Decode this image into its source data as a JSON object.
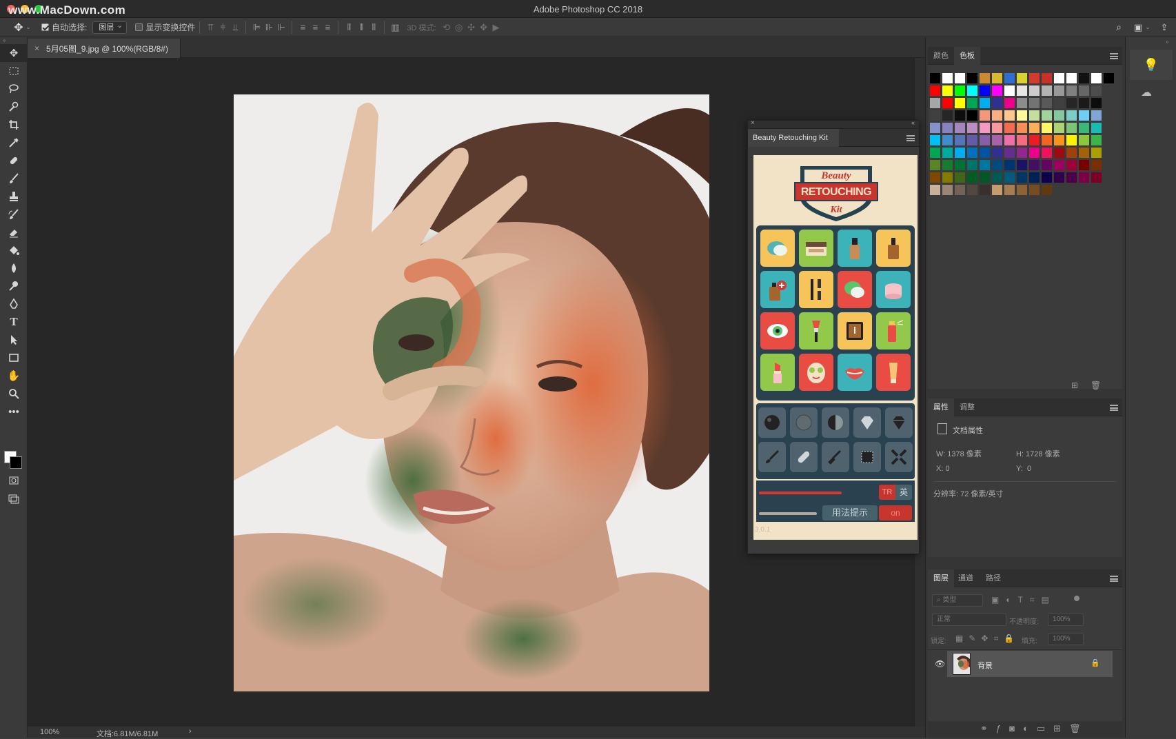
{
  "watermark": "www.MacDown.com",
  "app": {
    "title": "Adobe Photoshop CC 2018"
  },
  "options_bar": {
    "auto_select_label": "自动选择:",
    "auto_select_value": "图层",
    "show_transform_label": "显示变换控件",
    "mode_3d_label": "3D 模式:"
  },
  "document": {
    "tab_title": "5月05图_9.jpg @ 100%(RGB/8#)",
    "zoom": "100%",
    "doc_size": "文档:6.81M/6.81M"
  },
  "plugin": {
    "tab_title": "Beauty Retouching Kit",
    "logo_line1": "Beauty",
    "logo_line2": "RETOUCHING",
    "logo_line3": "Kit",
    "tr_label": "TR",
    "en_label": "英",
    "tip_label": "用法提示",
    "on_label": "on",
    "version": "3.0.1"
  },
  "color_panel": {
    "tabs": [
      "颜色",
      "色板"
    ],
    "active_tab": "色板"
  },
  "properties_panel": {
    "tabs": [
      "属性",
      "调整"
    ],
    "section_title": "文档属性",
    "width": "W: 1378 像素",
    "height": "H: 1728 像素",
    "x": "X: 0",
    "y": "0",
    "resolution": "分辨率: 72 像素/英寸"
  },
  "layers_panel": {
    "tabs": [
      "图层",
      "通道",
      "路径"
    ],
    "filter_placeholder": "类型",
    "blend_mode": "正常",
    "opacity_label": "不透明度:",
    "opacity_value": "100%",
    "lock_label": "锁定:",
    "fill_label": "填充:",
    "fill_value": "100%",
    "layer_name": "背景"
  },
  "colors": {
    "accent_red": "#c8342e",
    "kit_bg": "#f3e3c6",
    "kit_dark": "#2a4150"
  }
}
